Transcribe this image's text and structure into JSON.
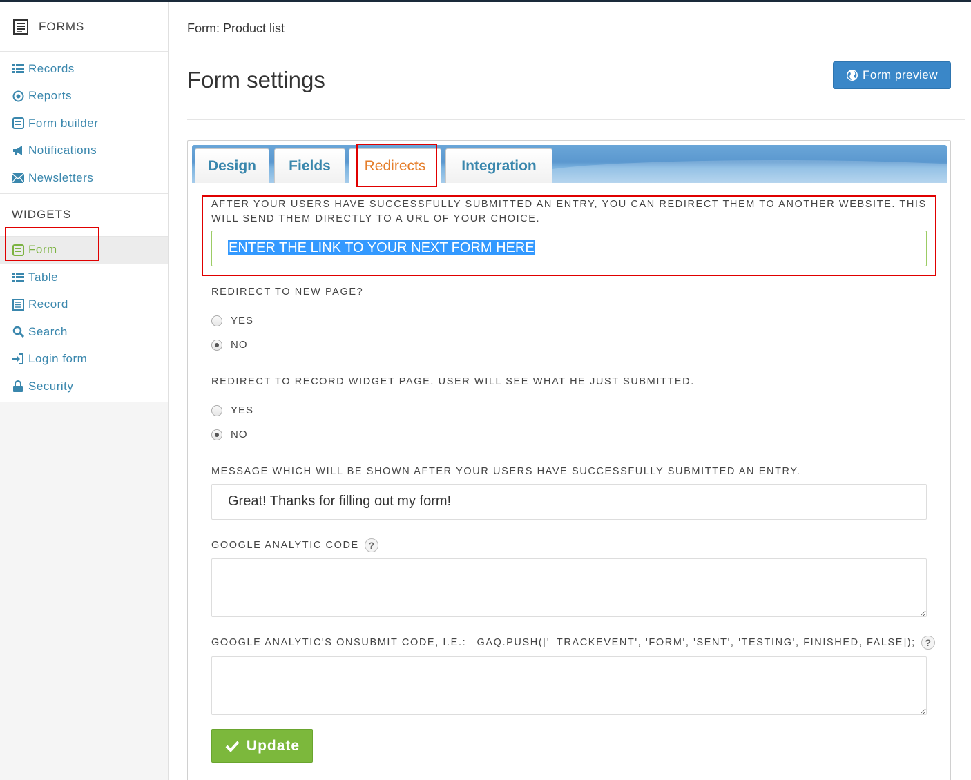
{
  "sidebar": {
    "header": "FORMS",
    "items": [
      {
        "label": "Records",
        "icon": "list-icon"
      },
      {
        "label": "Reports",
        "icon": "dot-circle-icon"
      },
      {
        "label": "Form builder",
        "icon": "form-builder-icon"
      },
      {
        "label": "Notifications",
        "icon": "bullhorn-icon"
      },
      {
        "label": "Newsletters",
        "icon": "envelope-icon"
      }
    ],
    "widgets_header": "WIDGETS",
    "widgets": [
      {
        "label": "Form",
        "icon": "form-icon",
        "active": true
      },
      {
        "label": "Table",
        "icon": "list-icon"
      },
      {
        "label": "Record",
        "icon": "record-icon"
      },
      {
        "label": "Search",
        "icon": "search-icon"
      },
      {
        "label": "Login form",
        "icon": "sign-in-icon"
      },
      {
        "label": "Security",
        "icon": "lock-icon"
      }
    ]
  },
  "breadcrumb": "Form: Product list",
  "page_title": "Form settings",
  "preview_button": "Form preview",
  "tabs": [
    {
      "label": "Design"
    },
    {
      "label": "Fields"
    },
    {
      "label": "Redirects",
      "active": true
    },
    {
      "label": "Integration"
    }
  ],
  "redirect_url": {
    "label": "After your users have successfully submitted an entry, you can redirect them to another website. This will send them directly to a URL of your choice.",
    "value": "ENTER THE LINK TO YOUR NEXT FORM HERE"
  },
  "redirect_new_page": {
    "label": "Redirect to new page?",
    "options": [
      "YES",
      "NO"
    ],
    "selected": "NO"
  },
  "redirect_record": {
    "label": "Redirect to Record widget page. User will see what he just submitted.",
    "options": [
      "YES",
      "NO"
    ],
    "selected": "NO"
  },
  "success_message": {
    "label": "Message which will be shown after your users have successfully submitted an entry.",
    "value": "Great! Thanks for filling out my form!"
  },
  "ga_code": {
    "label": "Google Analytic code",
    "help": "?",
    "value": ""
  },
  "ga_onsubmit": {
    "label": "Google Analytic's onSubmit code, i.e.: _gaq.push(['_trackEvent', 'Form', 'Sent', 'Testing', finished, false]);",
    "help": "?",
    "value": ""
  },
  "update_button": "Update",
  "colors": {
    "link": "#3a87ad",
    "active_green": "#7cb342",
    "active_tab": "#e57e2b",
    "primary_button": "#3a87c8",
    "success_button": "#7cb83c",
    "highlight": "#e00000"
  }
}
